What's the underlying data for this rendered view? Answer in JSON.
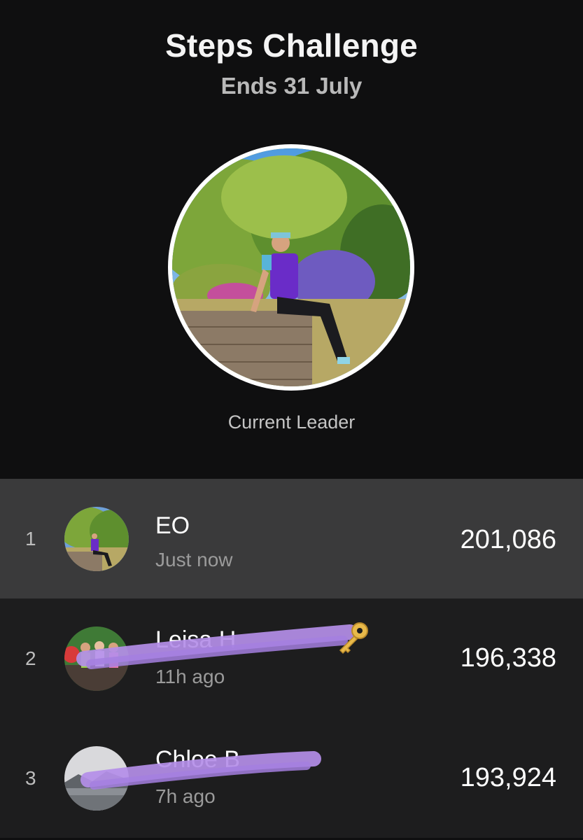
{
  "challenge": {
    "title": "Steps Challenge",
    "ends": "Ends 31 July",
    "leader_caption": "Current Leader"
  },
  "leaderboard": [
    {
      "rank": "1",
      "name": "EO",
      "updated": "Just now",
      "steps": "201,086",
      "highlighted": true
    },
    {
      "rank": "2",
      "name": "Leisa H",
      "updated": "11h ago",
      "steps": "196,338",
      "highlighted": false
    },
    {
      "rank": "3",
      "name": "Chloe B",
      "updated": "7h ago",
      "steps": "193,924",
      "highlighted": false
    }
  ],
  "colors": {
    "background": "#0f0f10",
    "row_background": "#1d1d1e",
    "row_highlight": "#3a3a3b",
    "redaction_purple": "#b48ee8"
  },
  "icons": {
    "redaction_emoji": "key-icon"
  }
}
